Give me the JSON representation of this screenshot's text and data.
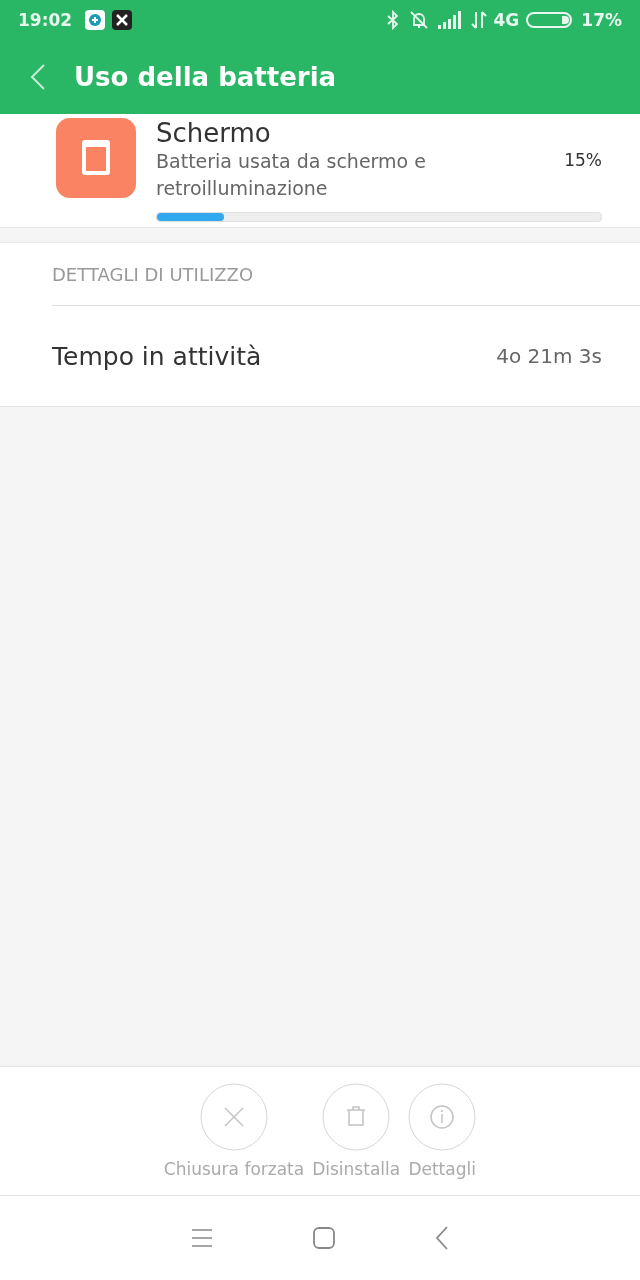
{
  "status_bar": {
    "time": "19:02",
    "network": "4G",
    "battery": "17%"
  },
  "toolbar": {
    "title": "Uso della batteria"
  },
  "item": {
    "name": "Schermo",
    "description": "Batteria usata da schermo e retroilluminazione",
    "percent": "15%",
    "level": 0.15
  },
  "details": {
    "header": "DETTAGLI DI UTILIZZO",
    "rows": [
      {
        "label": "Tempo in attività",
        "value": "4o 21m 3s"
      }
    ]
  },
  "actions": [
    {
      "kind": "close",
      "label": "Chiusura forzata"
    },
    {
      "kind": "uninstall",
      "label": "Disinstalla"
    },
    {
      "kind": "info",
      "label": "Dettagli"
    }
  ]
}
